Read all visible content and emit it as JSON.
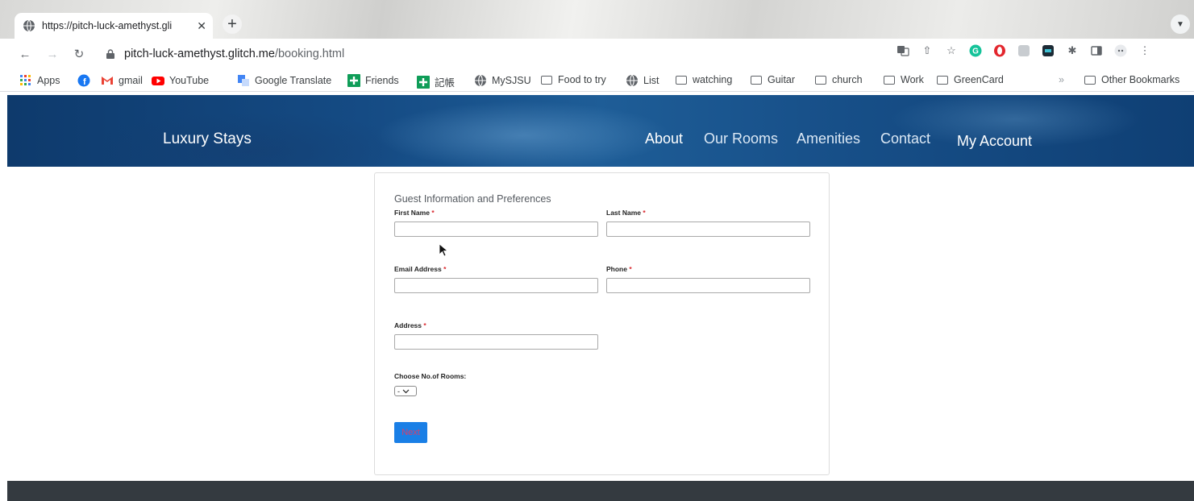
{
  "browser": {
    "tab_title": "https://pitch-luck-amethyst.gli",
    "tab_close": "✕",
    "new_tab": "+",
    "url_host": "pitch-luck-amethyst.glitch.me",
    "url_path": "/booking.html",
    "bookmarks": [
      {
        "label": "Apps",
        "icon": "apps-grid-icon"
      },
      {
        "label": "",
        "icon": "facebook-icon"
      },
      {
        "label": "gmail",
        "icon": "gmail-icon"
      },
      {
        "label": "YouTube",
        "icon": "youtube-icon"
      },
      {
        "label": "Google Translate",
        "icon": "translate-icon"
      },
      {
        "label": "Friends",
        "icon": "plus-green-icon"
      },
      {
        "label": "記帳",
        "icon": "plus-green-icon"
      },
      {
        "label": "MySJSU",
        "icon": "globe-icon"
      },
      {
        "label": "Food to try",
        "icon": "folder-icon"
      },
      {
        "label": "List",
        "icon": "globe-icon"
      },
      {
        "label": "watching",
        "icon": "folder-icon"
      },
      {
        "label": "Guitar",
        "icon": "folder-icon"
      },
      {
        "label": "church",
        "icon": "folder-icon"
      },
      {
        "label": "Work",
        "icon": "folder-icon"
      },
      {
        "label": "GreenCard",
        "icon": "folder-icon"
      }
    ],
    "overflow_chevron": "»",
    "other_bookmarks": "Other Bookmarks"
  },
  "site": {
    "brand": "Luxury Stays",
    "nav": [
      "About",
      "Our Rooms",
      "Amenities",
      "Contact",
      "My Account"
    ]
  },
  "form": {
    "title": "Guest Information and Preferences",
    "first_name_label": "First Name",
    "last_name_label": "Last Name",
    "email_label": "Email Address",
    "phone_label": "Phone",
    "address_label": "Address",
    "required_mark": "*",
    "rooms_label": "Choose No.of Rooms:",
    "rooms_selected": "-",
    "next_label": "Next",
    "first_name_value": "",
    "last_name_value": "",
    "email_value": "",
    "phone_value": "",
    "address_value": ""
  },
  "colors": {
    "header_blue": "#154b84",
    "button_blue": "#1a7fe6",
    "required_red": "#d9262c",
    "footer_dark": "#343a40"
  }
}
